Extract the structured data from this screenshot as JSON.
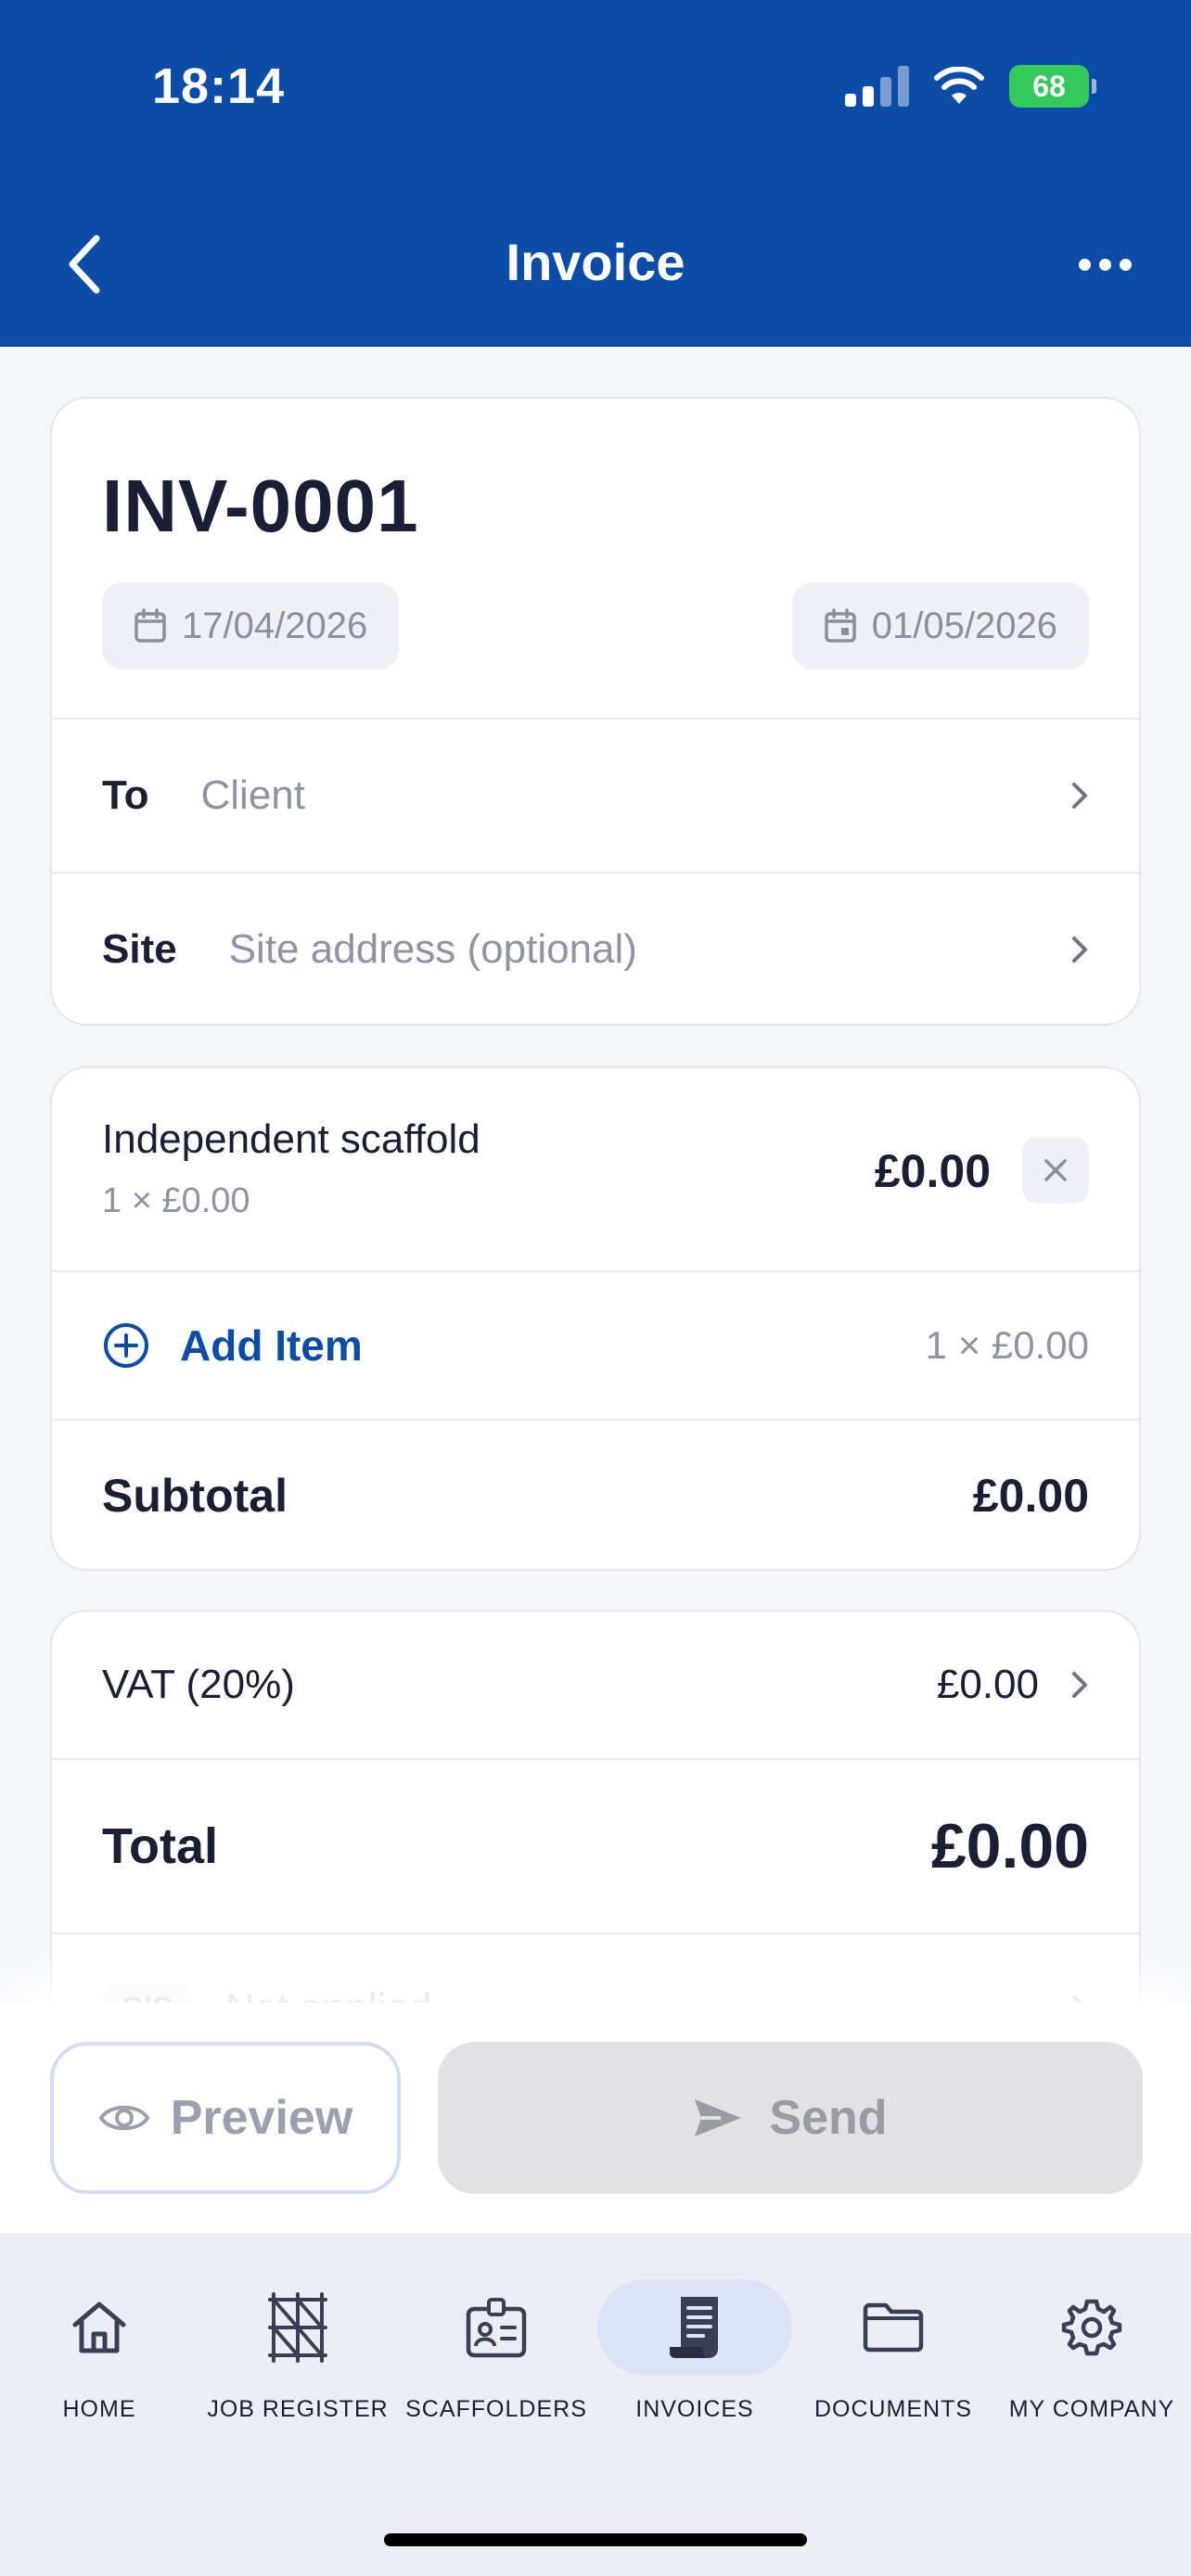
{
  "status_bar": {
    "time": "18:14",
    "battery": "68"
  },
  "nav": {
    "title": "Invoice"
  },
  "invoice": {
    "number": "INV-0001",
    "issue_date": "17/04/2026",
    "due_date": "01/05/2026",
    "to_label": "To",
    "to_placeholder": "Client",
    "site_label": "Site",
    "site_placeholder": "Site address (optional)"
  },
  "items": [
    {
      "name": "Independent scaffold",
      "qty_price": "1 × £0.00",
      "amount": "£0.00"
    }
  ],
  "add_item": {
    "label": "Add Item",
    "hint": "1 × £0.00"
  },
  "subtotal": {
    "label": "Subtotal",
    "value": "£0.00"
  },
  "vat": {
    "label": "VAT (20%)",
    "value": "£0.00"
  },
  "total": {
    "label": "Total",
    "value": "£0.00"
  },
  "cis": {
    "badge": "CIS",
    "text": "Not applied"
  },
  "actions": {
    "preview": "Preview",
    "send": "Send"
  },
  "tabs": [
    {
      "label": "HOME",
      "icon": "home-icon"
    },
    {
      "label": "JOB REGISTER",
      "icon": "scaffold-icon"
    },
    {
      "label": "SCAFFOLDERS",
      "icon": "id-badge-icon"
    },
    {
      "label": "INVOICES",
      "icon": "receipt-icon",
      "active": true
    },
    {
      "label": "DOCUMENTS",
      "icon": "folder-icon"
    },
    {
      "label": "MY COMPANY",
      "icon": "gear-icon"
    }
  ],
  "colors": {
    "primary": "#0b4ca8",
    "battery": "#34c759",
    "active_tab": "#dde3f8"
  }
}
